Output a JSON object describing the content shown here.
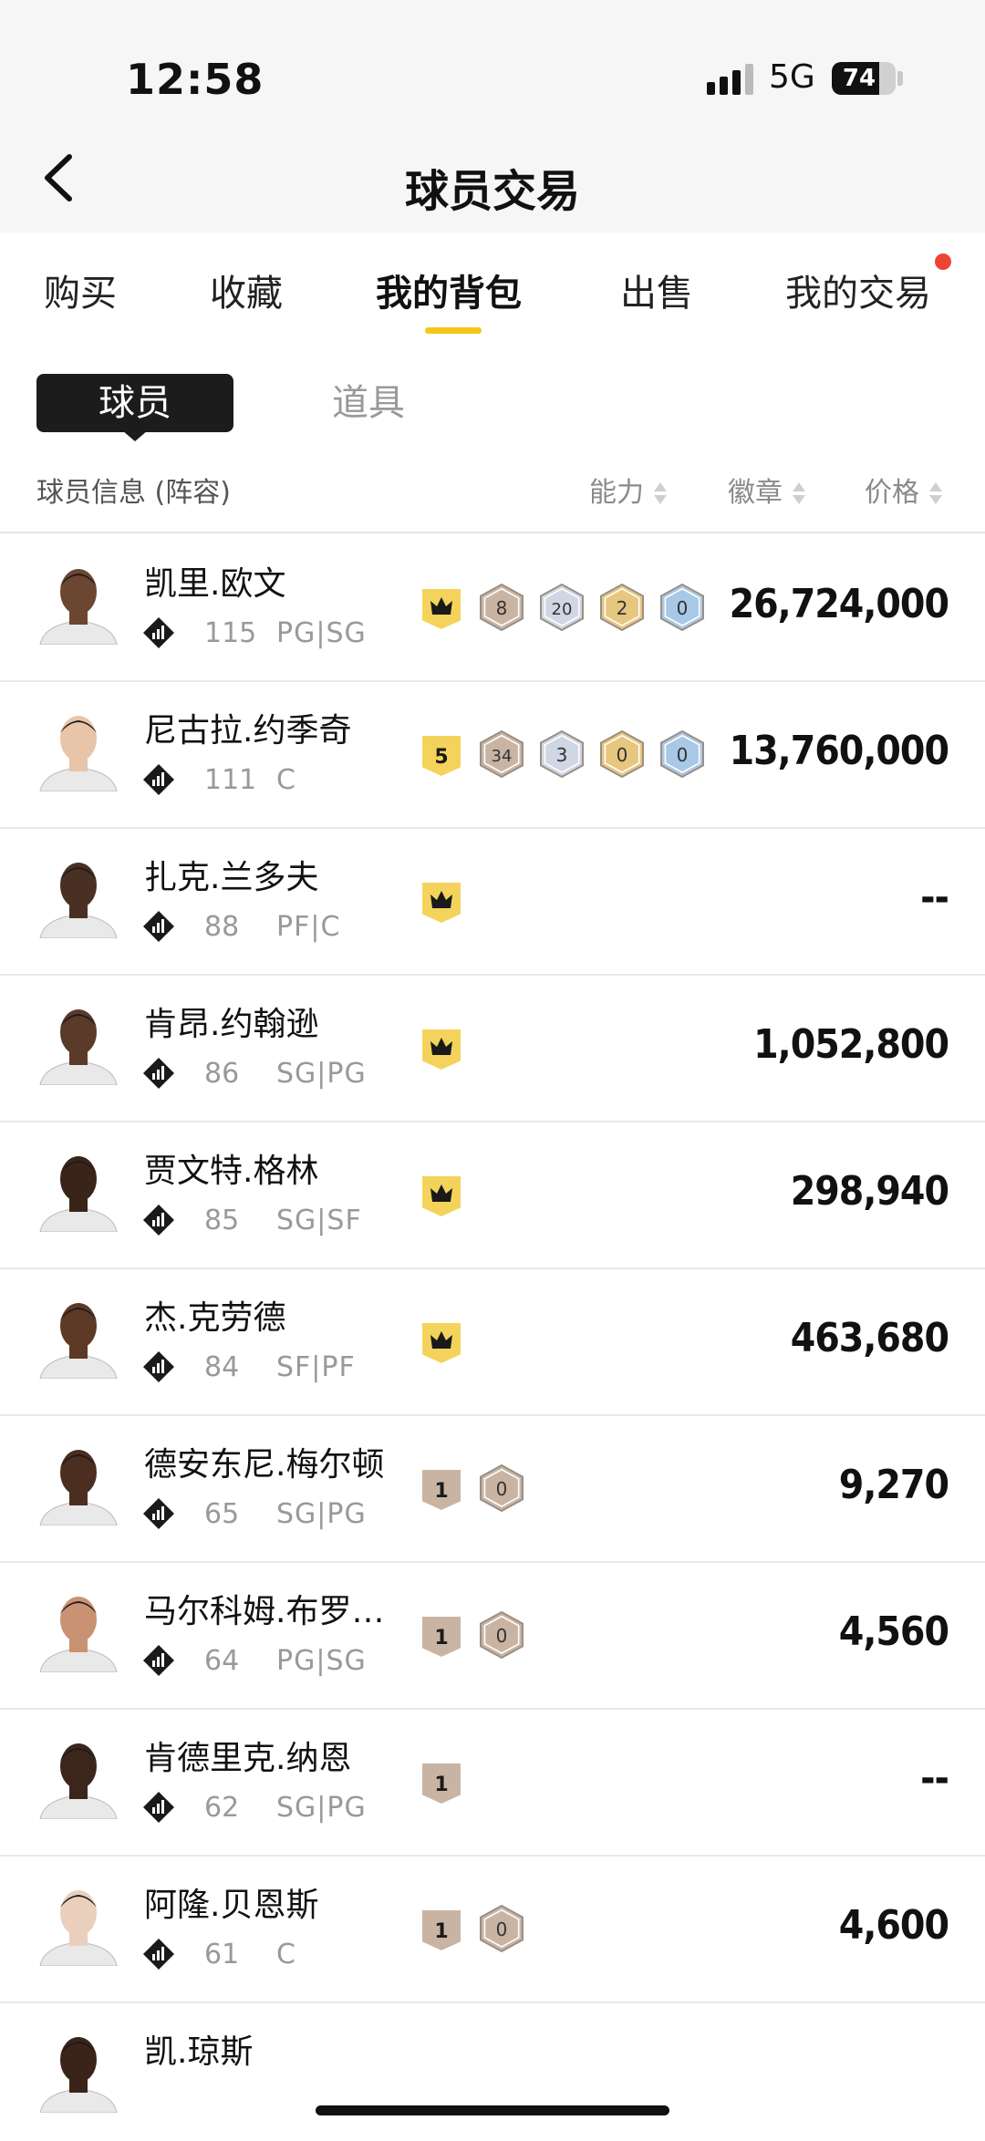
{
  "status": {
    "time": "12:58",
    "network": "5G",
    "battery": "74",
    "battery_level": 0.74
  },
  "header": {
    "title": "球员交易"
  },
  "tabs": [
    {
      "label": "购买",
      "active": false
    },
    {
      "label": "收藏",
      "active": false
    },
    {
      "label": "我的背包",
      "active": true
    },
    {
      "label": "出售",
      "active": false
    },
    {
      "label": "我的交易",
      "active": false,
      "has_dot": true
    }
  ],
  "subtabs": {
    "active": "球员",
    "other": "道具"
  },
  "columns": {
    "info": "球员信息 (阵容)",
    "ability": "能力",
    "badges": "徽章",
    "price": "价格"
  },
  "colors": {
    "accent": "#f5c518",
    "notify": "#ee4433",
    "crown": "#f3d35b",
    "bronze": "#c9b4a3",
    "silver": "#cfd6e4",
    "gold": "#e7c680",
    "hof": "#a9c8e6"
  },
  "players": [
    {
      "name": "凯里.欧文",
      "ovr": "115",
      "pos": "PG|SG",
      "tier": "crown",
      "badges": [
        "8",
        "20",
        "2",
        "0"
      ],
      "price": "26,724,000",
      "skin": "#6b4630"
    },
    {
      "name": "尼古拉.约季奇",
      "ovr": "111",
      "pos": "C",
      "tier": "5",
      "badges": [
        "34",
        "3",
        "0",
        "0"
      ],
      "price": "13,760,000",
      "skin": "#e8c4a8"
    },
    {
      "name": "扎克.兰多夫",
      "ovr": "88",
      "pos": "PF|C",
      "tier": "crown",
      "badges": [],
      "price": "--",
      "skin": "#4a3022"
    },
    {
      "name": "肯昂.约翰逊",
      "ovr": "86",
      "pos": "SG|PG",
      "tier": "crown",
      "badges": [],
      "price": "1,052,800",
      "skin": "#5a3a28"
    },
    {
      "name": "贾文特.格林",
      "ovr": "85",
      "pos": "SG|SF",
      "tier": "crown",
      "badges": [],
      "price": "298,940",
      "skin": "#3a2419"
    },
    {
      "name": "杰.克劳德",
      "ovr": "84",
      "pos": "SF|PF",
      "tier": "crown",
      "badges": [],
      "price": "463,680",
      "skin": "#5c3a26"
    },
    {
      "name": "德安东尼.梅尔顿",
      "ovr": "65",
      "pos": "SG|PG",
      "tier": "1",
      "badges": [
        "0"
      ],
      "price": "9,270",
      "skin": "#4b2e20"
    },
    {
      "name": "马尔科姆.布罗…",
      "ovr": "64",
      "pos": "PG|SG",
      "tier": "1",
      "badges": [
        "0"
      ],
      "price": "4,560",
      "skin": "#c99272"
    },
    {
      "name": "肯德里克.纳恩",
      "ovr": "62",
      "pos": "SG|PG",
      "tier": "1",
      "badges": [],
      "price": "--",
      "skin": "#3c261b"
    },
    {
      "name": "阿隆.贝恩斯",
      "ovr": "61",
      "pos": "C",
      "tier": "1",
      "badges": [
        "0"
      ],
      "price": "4,600",
      "skin": "#ead0bc"
    },
    {
      "name": "凯.琼斯",
      "ovr": "",
      "pos": "",
      "tier": "",
      "badges": [],
      "price": "",
      "skin": "#3a2419"
    }
  ]
}
